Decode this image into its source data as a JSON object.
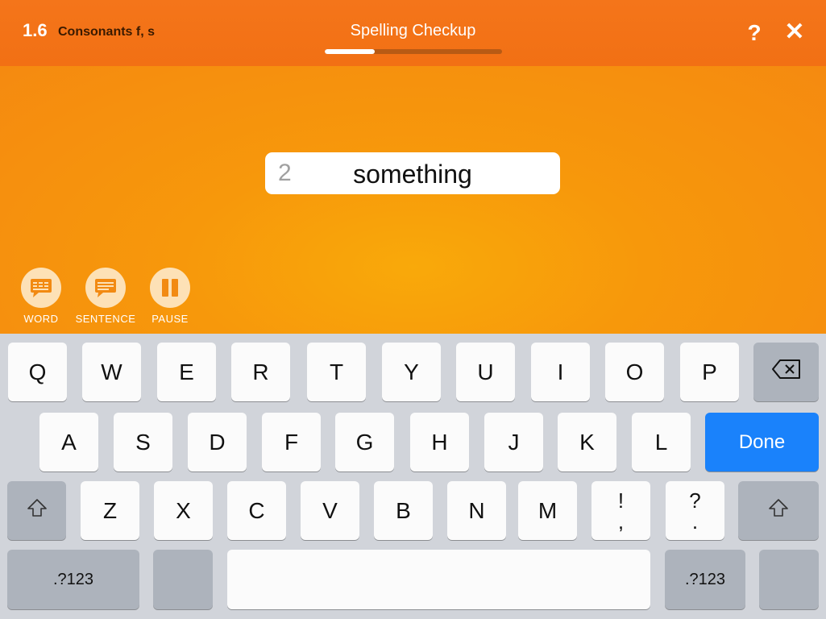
{
  "header": {
    "lesson_number": "1.6",
    "lesson_title": "Consonants f, s",
    "screen_title": "Spelling Checkup",
    "progress_fraction": 0.28,
    "help_label": "?",
    "close_label": "✕"
  },
  "answer": {
    "number": "2",
    "word": "something"
  },
  "audio_controls": {
    "word_label": "WORD",
    "sentence_label": "SENTENCE",
    "pause_label": "PAUSE"
  },
  "keyboard": {
    "row1": [
      "Q",
      "W",
      "E",
      "R",
      "T",
      "Y",
      "U",
      "I",
      "O",
      "P"
    ],
    "row2": [
      "A",
      "S",
      "D",
      "F",
      "G",
      "H",
      "J",
      "K",
      "L"
    ],
    "done_label": "Done",
    "row3": [
      "Z",
      "X",
      "C",
      "V",
      "B",
      "N",
      "M"
    ],
    "exclaim_top": "!",
    "exclaim_bottom": ",",
    "question_top": "?",
    "question_bottom": ".",
    "numbers_label": ".?123",
    "icons": {
      "backspace": "backspace-icon",
      "shift": "shift-icon"
    }
  },
  "colors": {
    "header_orange": "#f27014",
    "body_orange": "#f7980b",
    "done_blue": "#1a82fb",
    "keyboard_bg": "#d1d4da"
  }
}
